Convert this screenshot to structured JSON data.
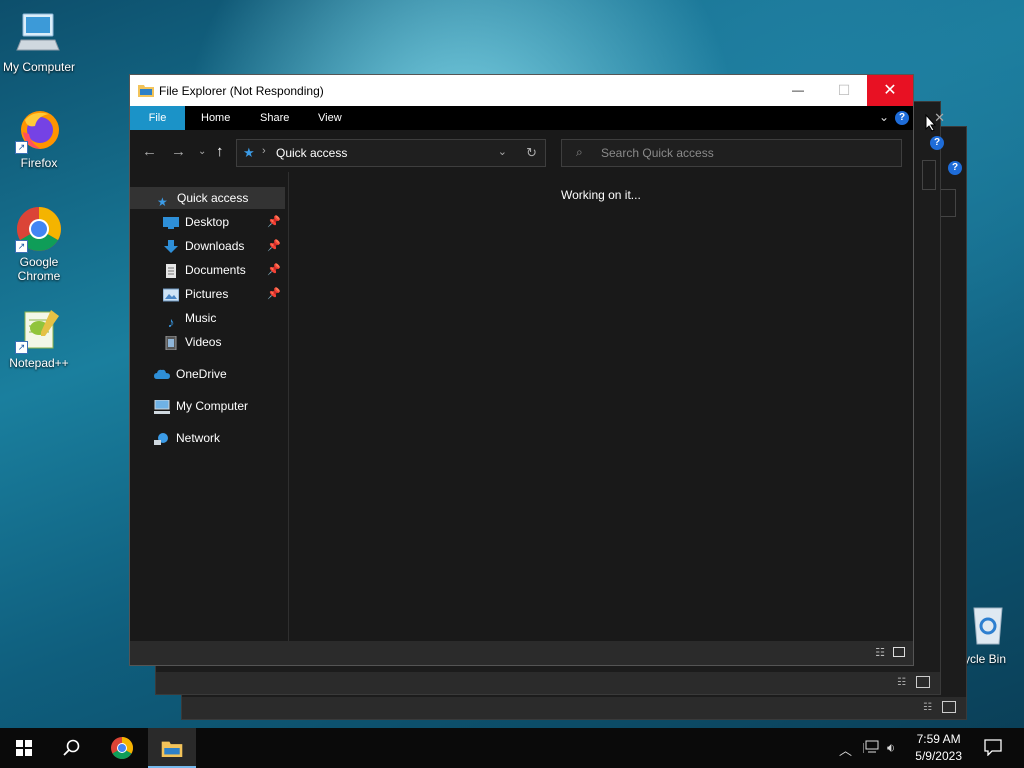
{
  "desktop": {
    "icons": [
      {
        "label": "My Computer"
      },
      {
        "label": "Firefox"
      },
      {
        "label": "Google Chrome"
      },
      {
        "label": "Notepad++"
      },
      {
        "label": "Recycle Bin"
      }
    ],
    "recycle_visible_label": "ycle Bin"
  },
  "explorer": {
    "title": "File Explorer (Not Responding)",
    "window_buttons": {
      "minimize": "—",
      "maximize": "☐",
      "close": "✕"
    },
    "ribbon_tabs": [
      "File",
      "Home",
      "Share",
      "View"
    ],
    "address": {
      "location": "Quick access"
    },
    "search": {
      "placeholder": "Search Quick access"
    },
    "status_message": "Working on it...",
    "sidebar": {
      "quick_access": "Quick access",
      "pinned": [
        {
          "label": "Desktop",
          "pinned": true
        },
        {
          "label": "Downloads",
          "pinned": true
        },
        {
          "label": "Documents",
          "pinned": true
        },
        {
          "label": "Pictures",
          "pinned": true
        },
        {
          "label": "Music",
          "pinned": false
        },
        {
          "label": "Videos",
          "pinned": false
        }
      ],
      "onedrive": "OneDrive",
      "my_computer": "My Computer",
      "network": "Network"
    }
  },
  "taskbar": {
    "time": "7:59 AM",
    "date": "5/9/2023"
  },
  "colors": {
    "accent": "#1b93c8",
    "close_red": "#e81123",
    "dark_bg": "#191919",
    "taskbar_bg": "#0a0a0a"
  }
}
